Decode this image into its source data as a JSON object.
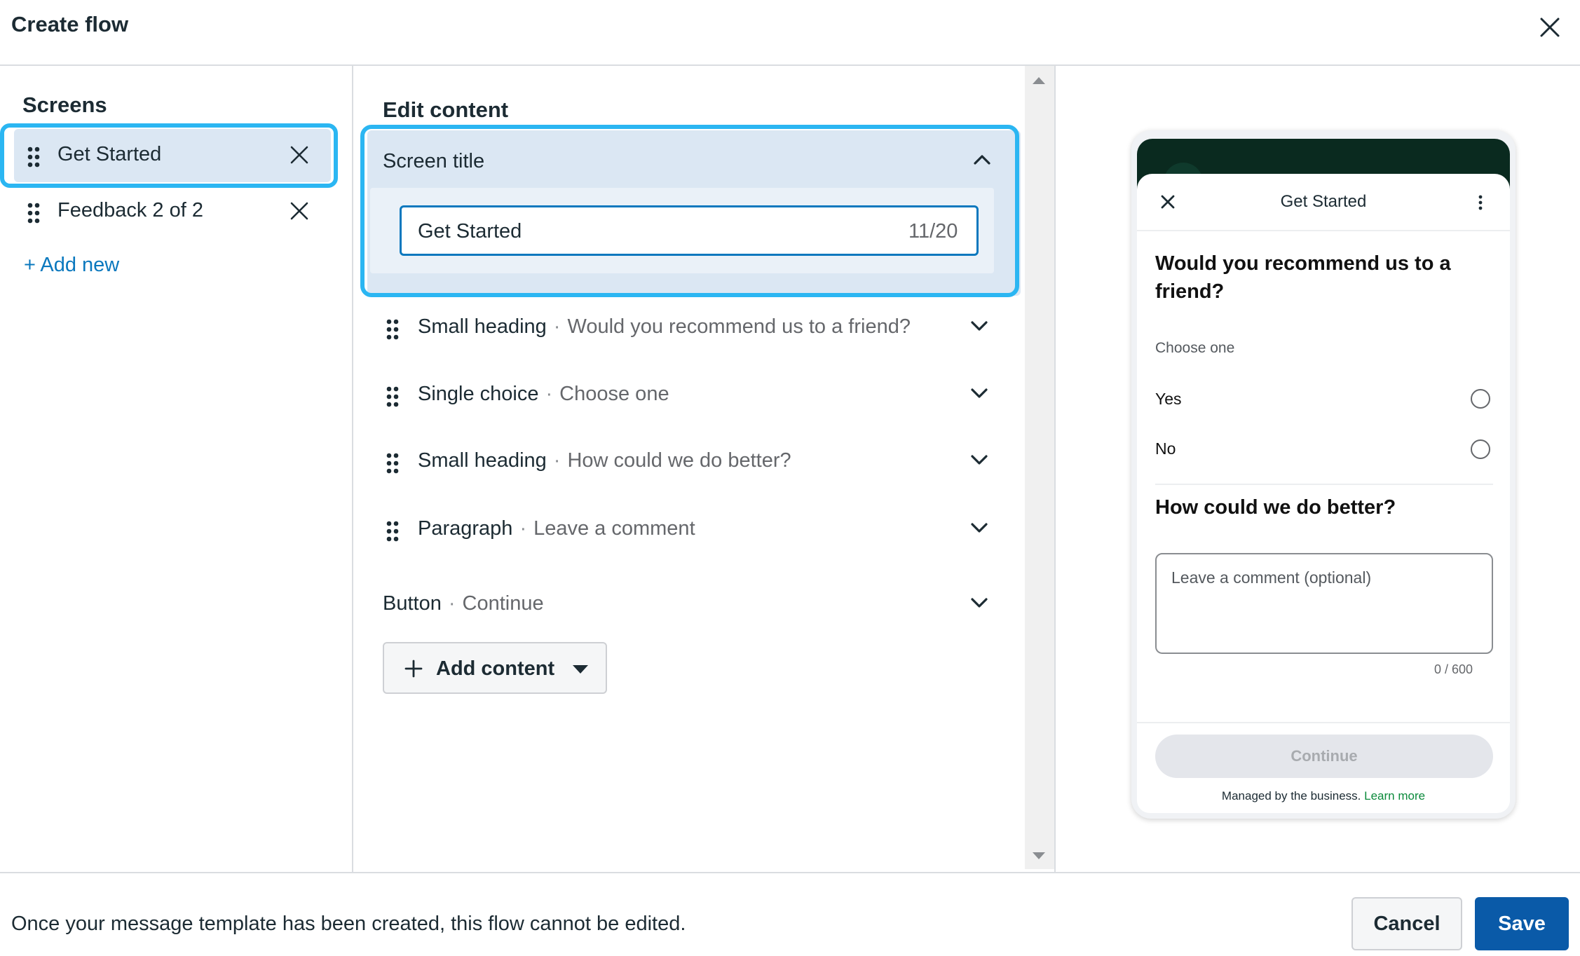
{
  "dialog": {
    "title": "Create flow"
  },
  "screens": {
    "title": "Screens",
    "items": [
      {
        "label": "Get Started",
        "selected": true
      },
      {
        "label": "Feedback 2 of 2",
        "selected": false
      }
    ],
    "add_new": "+ Add new"
  },
  "editor": {
    "title": "Edit content",
    "screen_title": {
      "label": "Screen title",
      "value": "Get Started",
      "count": "11/20"
    },
    "rows": [
      {
        "type": "Small heading",
        "value": "Would you recommend us to a friend?"
      },
      {
        "type": "Single choice",
        "value": "Choose one"
      },
      {
        "type": "Small heading",
        "value": "How could we do better?"
      },
      {
        "type": "Paragraph",
        "value": "Leave a comment"
      }
    ],
    "button_row": {
      "type": "Button",
      "value": "Continue"
    },
    "separator": "·",
    "add_content": "Add content"
  },
  "preview": {
    "header_title": "Get Started",
    "question1": "Would you recommend us to a friend?",
    "choose_label": "Choose one",
    "options": [
      "Yes",
      "No"
    ],
    "question2": "How could we do better?",
    "textarea_placeholder": "Leave a comment (optional)",
    "counter": "0 / 600",
    "continue_label": "Continue",
    "managed_text": "Managed by the business.",
    "learn_more": "Learn more"
  },
  "footer": {
    "note": "Once your message template has been created, this flow cannot be edited.",
    "cancel": "Cancel",
    "save": "Save"
  },
  "colors": {
    "accent": "#0a78be",
    "highlight": "#2bb6f2",
    "selected_bg": "#dbe7f3",
    "save_bg": "#0a5aa8",
    "link_green": "#0b8a3b"
  }
}
